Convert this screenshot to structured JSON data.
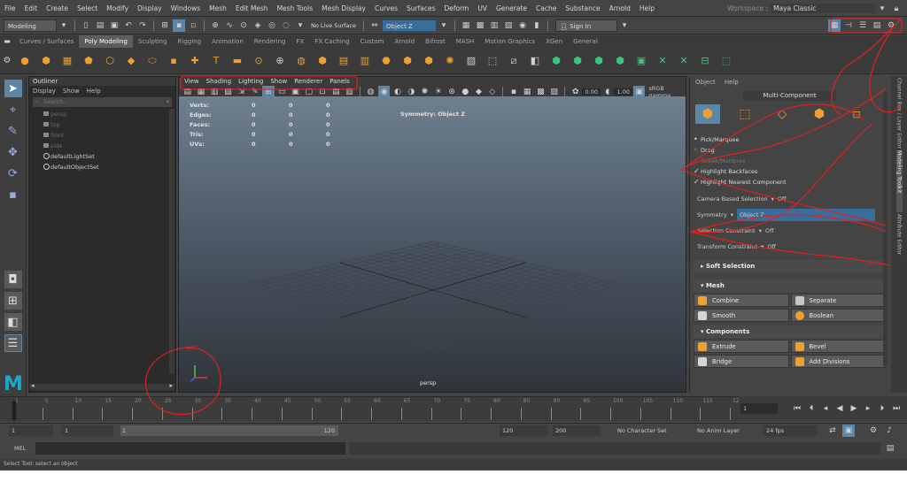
{
  "menubar": {
    "items": [
      "File",
      "Edit",
      "Create",
      "Select",
      "Modify",
      "Display",
      "Windows",
      "Mesh",
      "Edit Mesh",
      "Mesh Tools",
      "Mesh Display",
      "Curves",
      "Surfaces",
      "Deform",
      "UV",
      "Generate",
      "Cache",
      "Substance",
      "Arnold",
      "Help"
    ],
    "workspace_label": "Workspace :",
    "workspace_value": "Maya Classic"
  },
  "statusline": {
    "mode": "Modeling",
    "live_surface": "No Live Surface",
    "symmetry_field": "Object Z",
    "sign_in": "Sign In"
  },
  "shelf": {
    "tabs": [
      "Curves / Surfaces",
      "Poly Modeling",
      "Sculpting",
      "Rigging",
      "Animation",
      "Rendering",
      "FX",
      "FX Caching",
      "Custom",
      "Arnold",
      "Bifrost",
      "MASH",
      "Motion Graphics",
      "XGen",
      "General"
    ],
    "active_tab": "Poly Modeling",
    "icon_colors": [
      "#f0a030",
      "#f0a030",
      "#f0a030",
      "#f0a030",
      "#f0a030",
      "#f0a030",
      "#f0a030",
      "#f0a030",
      "#f0a030",
      "#f0a030",
      "#f0a030",
      "#f0a030",
      "#d0d0d0",
      "#f0a030",
      "#f0a030",
      "#f0a030",
      "#f0a030",
      "#f0a030",
      "#f0a030",
      "#f0a030",
      "#f0a030",
      "#d0d0d0",
      "#d0d0d0",
      "#d0d0d0",
      "#d0d0d0",
      "#3cc87a",
      "#3cc87a",
      "#3cc87a",
      "#3cc87a",
      "#3cc87a",
      "#3cc87a",
      "#3cc87a",
      "#3cc87a",
      "#3cc87a"
    ]
  },
  "outliner": {
    "title": "Outliner",
    "menu": [
      "Display",
      "Show",
      "Help"
    ],
    "search_placeholder": "Search...",
    "items": [
      {
        "label": "persp",
        "style": "dim"
      },
      {
        "label": "top",
        "style": "dim"
      },
      {
        "label": "front",
        "style": "dim"
      },
      {
        "label": "side",
        "style": "dim"
      },
      {
        "label": "defaultLightSet",
        "style": "light"
      },
      {
        "label": "defaultObjectSet",
        "style": "light"
      }
    ]
  },
  "viewport": {
    "menu": [
      "View",
      "Shading",
      "Lighting",
      "Show",
      "Renderer",
      "Panels"
    ],
    "exposure": "0.00",
    "gamma": "1.00",
    "color_space": "sRGB gamma",
    "hud": {
      "rows": [
        {
          "label": "Verts:",
          "a": "0",
          "b": "0",
          "c": "0"
        },
        {
          "label": "Edges:",
          "a": "0",
          "b": "0",
          "c": "0"
        },
        {
          "label": "Faces:",
          "a": "0",
          "b": "0",
          "c": "0"
        },
        {
          "label": "Tris:",
          "a": "0",
          "b": "0",
          "c": "0"
        },
        {
          "label": "UVs:",
          "a": "0",
          "b": "0",
          "c": "0"
        }
      ],
      "symmetry": "Symmetry: Object Z"
    },
    "camera_label": "persp"
  },
  "rightpanel": {
    "menu": [
      "Object",
      "Help"
    ],
    "mode_title": "Multi-Component",
    "options": [
      {
        "label": "Pick/Marquee",
        "state": "radio-on"
      },
      {
        "label": "Drag",
        "state": "radio-off"
      },
      {
        "label": "Tweak/Marquee",
        "state": "dim"
      },
      {
        "label": "Highlight Backfaces",
        "state": "check"
      },
      {
        "label": "Highlight Nearest Component",
        "state": "check"
      }
    ],
    "camera_based_label": "Camera Based Selection",
    "camera_based_value": "Off",
    "symmetry_label": "Symmetry",
    "symmetry_value": "Object Z",
    "selection_constraint_label": "Selection Constraint",
    "selection_constraint_value": "Off",
    "transform_constraint_label": "Transform Constraint",
    "transform_constraint_value": "Off",
    "soft_selection": "Soft Selection",
    "mesh_section": "Mesh",
    "mesh_buttons": [
      "Combine",
      "Separate",
      "Smooth",
      "Boolean"
    ],
    "components_section": "Components",
    "component_buttons": [
      "Extrude",
      "Bevel",
      "Bridge",
      "Add Divisions"
    ],
    "vertical_tabs": [
      "Channel Box / Layer Editor",
      "Modeling Toolkit",
      "Attribute Editor"
    ]
  },
  "timeline": {
    "ticks": [
      "1",
      "5",
      "10",
      "15",
      "20",
      "25",
      "30",
      "35",
      "40",
      "45",
      "50",
      "55",
      "60",
      "65",
      "70",
      "75",
      "80",
      "85",
      "90",
      "95",
      "100",
      "105",
      "110",
      "115",
      "12"
    ],
    "current_frame": "1"
  },
  "rangebar": {
    "start": "1",
    "start2": "1",
    "range_start": "1",
    "range_end": "120",
    "end": "120",
    "end2": "200",
    "character_set": "No Character Set",
    "anim_layer": "No Anim Layer",
    "fps": "24 fps"
  },
  "mel": {
    "label": "MEL"
  },
  "helpline": {
    "text": "Select Tool: select an object"
  },
  "colors": {
    "accent": "#5c86a8",
    "annotation": "#e02020"
  }
}
